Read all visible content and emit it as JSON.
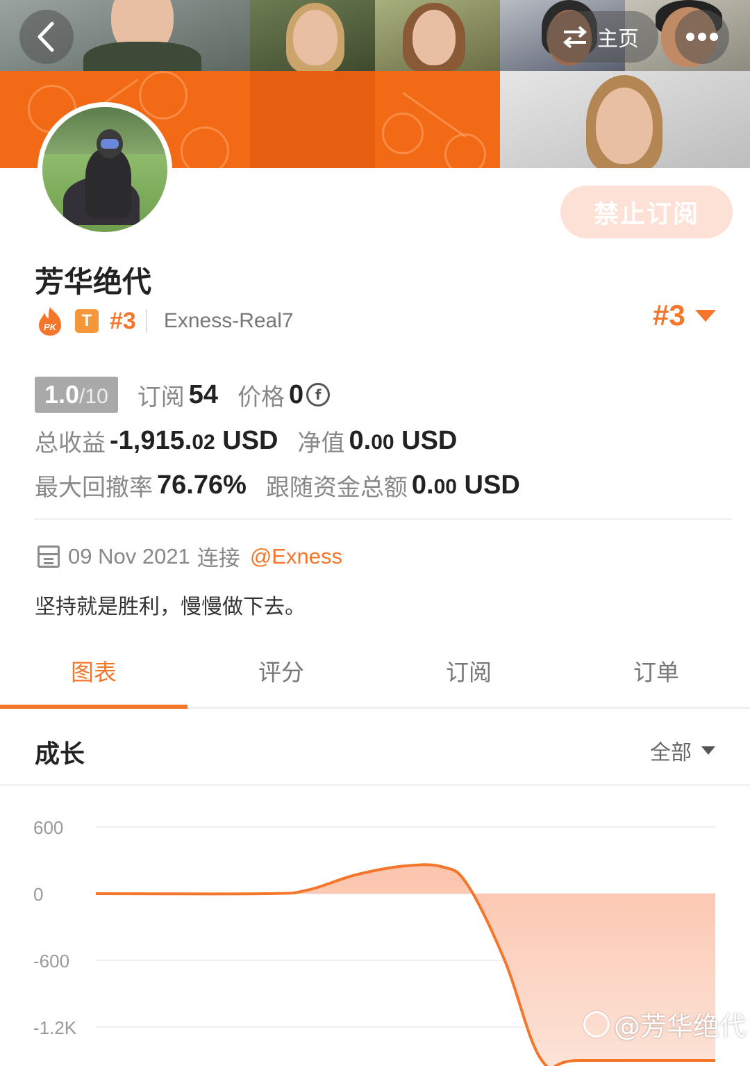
{
  "header": {
    "home_label": "主页"
  },
  "actions": {
    "ban_subscribe_label": "禁止订阅"
  },
  "profile": {
    "name": "芳华绝代",
    "rank": "#3",
    "account": "Exness-Real7",
    "rank_right": "#3",
    "tier_badge": "T",
    "pk_badge": "PK"
  },
  "stats": {
    "score": "1.0",
    "score_max": "/10",
    "subscribe_label": "订阅",
    "subscribe_value": "54",
    "price_label": "价格",
    "price_value": "0",
    "total_profit_label": "总收益",
    "total_profit_main": "-1,915.",
    "total_profit_dec": "02",
    "total_profit_unit": "USD",
    "equity_label": "净值",
    "equity_main": "0.",
    "equity_dec": "00",
    "equity_unit": "USD",
    "max_drawdown_label": "最大回撤率",
    "max_drawdown_value": "76.76%",
    "follow_funds_label": "跟随资金总额",
    "follow_funds_main": "0.",
    "follow_funds_dec": "00",
    "follow_funds_unit": "USD"
  },
  "joined": {
    "date": "09 Nov 2021",
    "connect_label": "连接",
    "broker": "@Exness"
  },
  "bio": "坚持就是胜利，慢慢做下去。",
  "tabs": [
    {
      "label": "图表"
    },
    {
      "label": "评分"
    },
    {
      "label": "订阅"
    },
    {
      "label": "订单"
    }
  ],
  "section": {
    "title": "成长",
    "filter_label": "全部"
  },
  "colors": {
    "accent": "#f5762a",
    "area_fill": "#fbc4ad"
  },
  "chart_data": {
    "type": "area",
    "title": "",
    "xlabel": "",
    "ylabel": "",
    "ylim": [
      -1300,
      700
    ],
    "y_ticks": [
      600,
      0,
      -600,
      -1200
    ],
    "y_tick_labels": [
      "600",
      "0",
      "-600",
      "-1.2K"
    ],
    "x": [
      0,
      0.27,
      0.34,
      0.42,
      0.5,
      0.56,
      0.6,
      0.66,
      0.72,
      0.78,
      1.0
    ],
    "values": [
      0,
      0,
      30,
      170,
      250,
      240,
      80,
      -600,
      -1500,
      -1500,
      -1500
    ],
    "series": [
      {
        "values": [
          0,
          0,
          30,
          170,
          250,
          240,
          80,
          -600,
          -1500,
          -1500,
          -1500
        ]
      }
    ],
    "baseline": 0,
    "grid": true
  },
  "watermark": "@芳华绝代"
}
